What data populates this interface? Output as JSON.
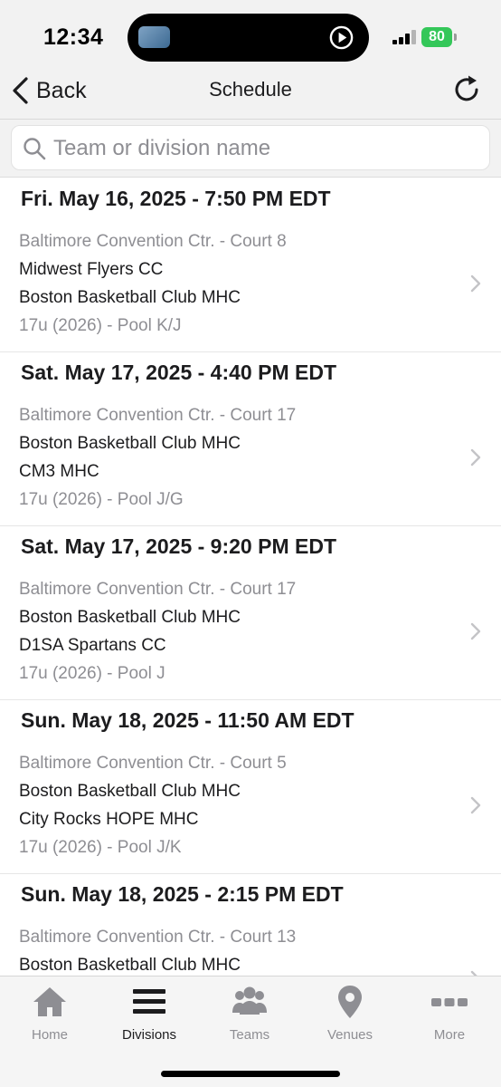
{
  "status_bar": {
    "time": "12:34",
    "battery": "80"
  },
  "nav": {
    "back_label": "Back",
    "title": "Schedule"
  },
  "search": {
    "placeholder": "Team or division name"
  },
  "schedule": [
    {
      "day": "Fri. May 16, 2025 - 7:50 PM EDT",
      "venue": "Baltimore Convention Ctr. - Court 8",
      "team1": "Midwest Flyers CC",
      "team2": "Boston Basketball Club MHC",
      "division": "17u (2026) - Pool K/J"
    },
    {
      "day": "Sat. May 17, 2025 - 4:40 PM EDT",
      "venue": "Baltimore Convention Ctr. - Court 17",
      "team1": "Boston Basketball Club MHC",
      "team2": "CM3 MHC",
      "division": "17u (2026) - Pool J/G"
    },
    {
      "day": "Sat. May 17, 2025 - 9:20 PM EDT",
      "venue": "Baltimore Convention Ctr. - Court 17",
      "team1": "Boston Basketball Club MHC",
      "team2": "D1SA Spartans CC",
      "division": "17u (2026) - Pool J"
    },
    {
      "day": "Sun. May 18, 2025 - 11:50 AM EDT",
      "venue": "Baltimore Convention Ctr. - Court 5",
      "team1": "Boston Basketball Club MHC",
      "team2": "City Rocks HOPE MHC",
      "division": "17u (2026) - Pool J/K"
    },
    {
      "day": "Sun. May 18, 2025 - 2:15 PM EDT",
      "venue": "Baltimore Convention Ctr. - Court 13",
      "team1": "Boston Basketball Club MHC",
      "team2": "",
      "division": ""
    }
  ],
  "tabs": [
    {
      "label": "Home",
      "icon": "home-icon",
      "active": false
    },
    {
      "label": "Divisions",
      "icon": "list-icon",
      "active": true
    },
    {
      "label": "Teams",
      "icon": "people-icon",
      "active": false
    },
    {
      "label": "Venues",
      "icon": "map-pin-icon",
      "active": false
    },
    {
      "label": "More",
      "icon": "more-icon",
      "active": false
    }
  ],
  "colors": {
    "accent": "#1c1c1e",
    "inactive": "#8e8e93",
    "battery": "#34c759"
  }
}
